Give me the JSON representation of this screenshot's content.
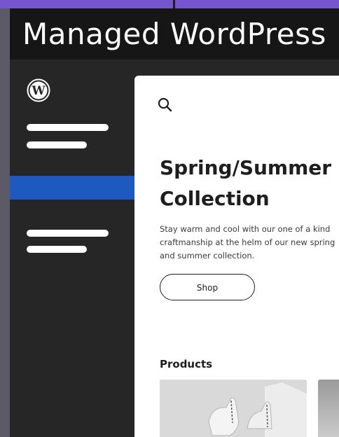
{
  "window": {
    "title": "Managed WordPress"
  },
  "sidebar": {
    "logo_icon": "wordpress-logo-icon",
    "accent_color": "#1c5ac0"
  },
  "content": {
    "search_icon": "search-icon",
    "hero": {
      "title_line1": "Spring/Summer",
      "title_line2": "Collection",
      "description": "Stay warm and cool with our one of a kind craftmanship at the helm of our new spring and summer collection.",
      "button_label": "Shop"
    },
    "products": {
      "heading": "Products"
    }
  }
}
